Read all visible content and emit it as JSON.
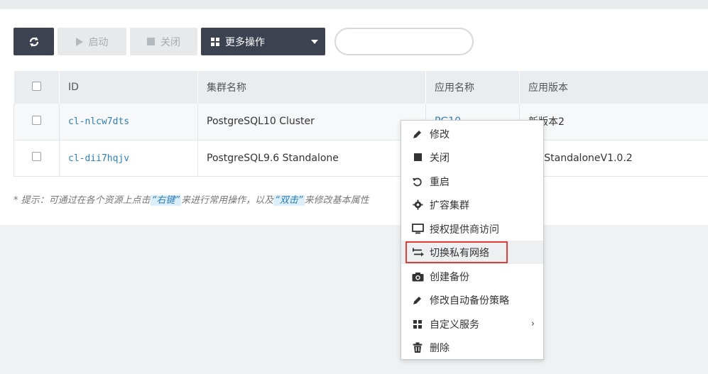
{
  "toolbar": {
    "start_label": "启动",
    "stop_label": "关闭",
    "more_label": "更多操作"
  },
  "search": {
    "placeholder": ""
  },
  "table": {
    "columns": [
      "",
      "ID",
      "集群名称",
      "应用名称",
      "应用版本"
    ],
    "rows": [
      {
        "id": "cl-nlcw7dts",
        "name": "PostgreSQL10 Cluster",
        "app": "PG10",
        "version": "新版本2"
      },
      {
        "id": "cl-dii7hqjv",
        "name": "PostgreSQL9.6 Standalone",
        "app": "",
        "version": "9.6StandaloneV1.0.2"
      }
    ]
  },
  "hint": {
    "prefix": "* 提示：可通过在各个资源上点击",
    "right_click": "“右键”",
    "middle": "来进行常用操作，以及",
    "double_click": "“双击”",
    "suffix": "来修改基本属性"
  },
  "context_menu": {
    "items": [
      {
        "label": "修改",
        "icon": "pencil-icon"
      },
      {
        "label": "关闭",
        "icon": "stop-icon"
      },
      {
        "label": "重启",
        "icon": "restart-icon"
      },
      {
        "label": "扩容集群",
        "icon": "gear-icon"
      },
      {
        "label": "授权提供商访问",
        "icon": "monitor-icon"
      },
      {
        "label": "切换私有网络",
        "icon": "switch-icon"
      },
      {
        "label": "创建备份",
        "icon": "camera-icon"
      },
      {
        "label": "修改自动备份策略",
        "icon": "pencil-icon"
      },
      {
        "label": "自定义服务",
        "icon": "grid-icon"
      },
      {
        "label": "删除",
        "icon": "trash-icon"
      }
    ],
    "submenu_arrow": "›"
  }
}
